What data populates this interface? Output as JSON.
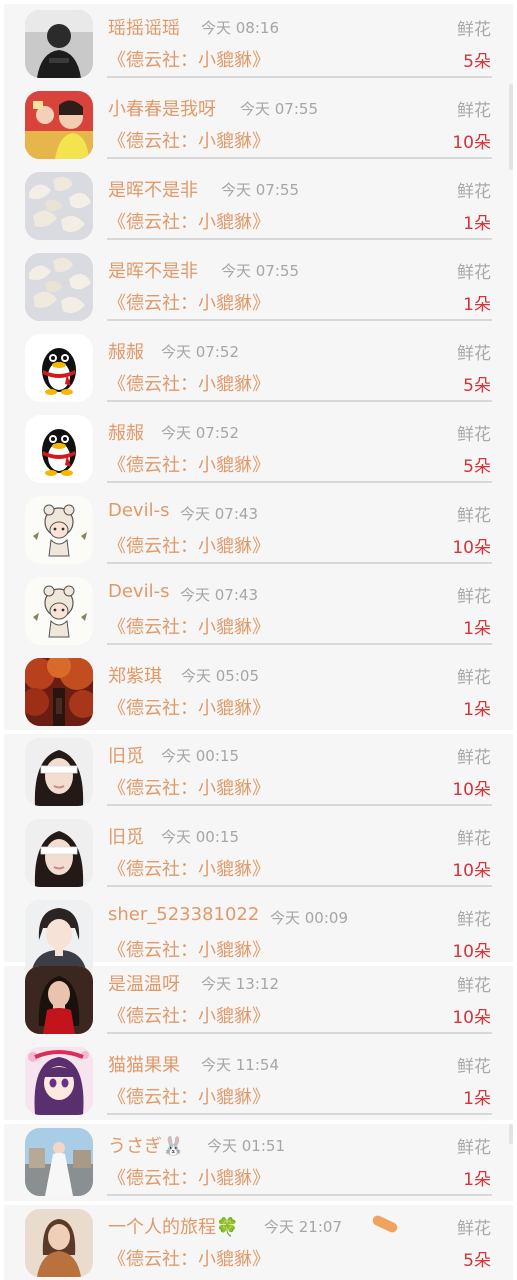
{
  "gift_records": [
    {
      "name": "瑶摇谣瑶",
      "time": "今天 08:16",
      "gift": "鲜花",
      "show": "《德云社：小貔貅》",
      "count": "5朵",
      "avatar": "man-dark-icon"
    },
    {
      "name": "小春春是我呀",
      "time": "今天 07:55",
      "gift": "鲜花",
      "show": "《德云社：小貔貅》",
      "count": "10朵",
      "avatar": "costume-actor-icon"
    },
    {
      "name": "是晖不是非",
      "time": "今天 07:55",
      "gift": "鲜花",
      "show": "《德云社：小貔貅》",
      "count": "1朵",
      "avatar": "dumplings-icon"
    },
    {
      "name": "是晖不是非",
      "time": "今天 07:55",
      "gift": "鲜花",
      "show": "《德云社：小貔貅》",
      "count": "1朵",
      "avatar": "dumplings-icon"
    },
    {
      "name": "赧赧",
      "time": "今天 07:52",
      "gift": "鲜花",
      "show": "《德云社：小貔貅》",
      "count": "5朵",
      "avatar": "penguin-icon"
    },
    {
      "name": "赧赧",
      "time": "今天 07:52",
      "gift": "鲜花",
      "show": "《德云社：小貔貅》",
      "count": "5朵",
      "avatar": "penguin-icon"
    },
    {
      "name": "Devil-s",
      "time": "今天 07:43",
      "gift": "鲜花",
      "show": "《德云社：小貔貅》",
      "count": "10朵",
      "avatar": "cartoon-girl-icon"
    },
    {
      "name": "Devil-s",
      "time": "今天 07:43",
      "gift": "鲜花",
      "show": "《德云社：小貔貅》",
      "count": "1朵",
      "avatar": "cartoon-girl-icon"
    },
    {
      "name": "郑紫琪",
      "time": "今天 05:05",
      "gift": "鲜花",
      "show": "《德云社：小貔貅》",
      "count": "1朵",
      "avatar": "autumn-scene-icon"
    },
    {
      "name": "旧觅",
      "time": "今天 00:15",
      "gift": "鲜花",
      "show": "《德云社：小貔貅》",
      "count": "10朵",
      "avatar": "girl-blindfold-icon"
    },
    {
      "name": "旧觅",
      "time": "今天 00:15",
      "gift": "鲜花",
      "show": "《德云社：小貔貅》",
      "count": "10朵",
      "avatar": "girl-blindfold-icon"
    },
    {
      "name": "sher_523381022",
      "time": "今天 00:09",
      "gift": "鲜花",
      "show": "《德云社：小貔貅》",
      "count": "10朵",
      "avatar": "anime-boy-icon"
    },
    {
      "name": "是温温呀",
      "time": "今天 13:12",
      "gift": "鲜花",
      "show": "《德云社：小貔貅》",
      "count": "10朵",
      "avatar": "girl-red-dress-icon"
    },
    {
      "name": "猫猫果果",
      "time": "今天 11:54",
      "gift": "鲜花",
      "show": "《德云社：小貔貅》",
      "count": "1朵",
      "avatar": "anime-girl-icon"
    },
    {
      "name": "うさぎ🐰",
      "time": "今天 01:51",
      "gift": "鲜花",
      "show": "《德云社：小貔貅》",
      "count": "1朵",
      "avatar": "bride-photo-icon"
    },
    {
      "name": "一个人的旅程🍀",
      "time": "今天 21:07",
      "gift": "鲜花",
      "show": "《德云社：小貔貅》",
      "count": "5朵",
      "avatar": "girl-brown-icon"
    }
  ],
  "colors": {
    "name_accent": "#e09a6a",
    "count_red": "#d2343a",
    "muted_gray": "#a6a6a6",
    "panel_bg": "#f6f6f6"
  }
}
